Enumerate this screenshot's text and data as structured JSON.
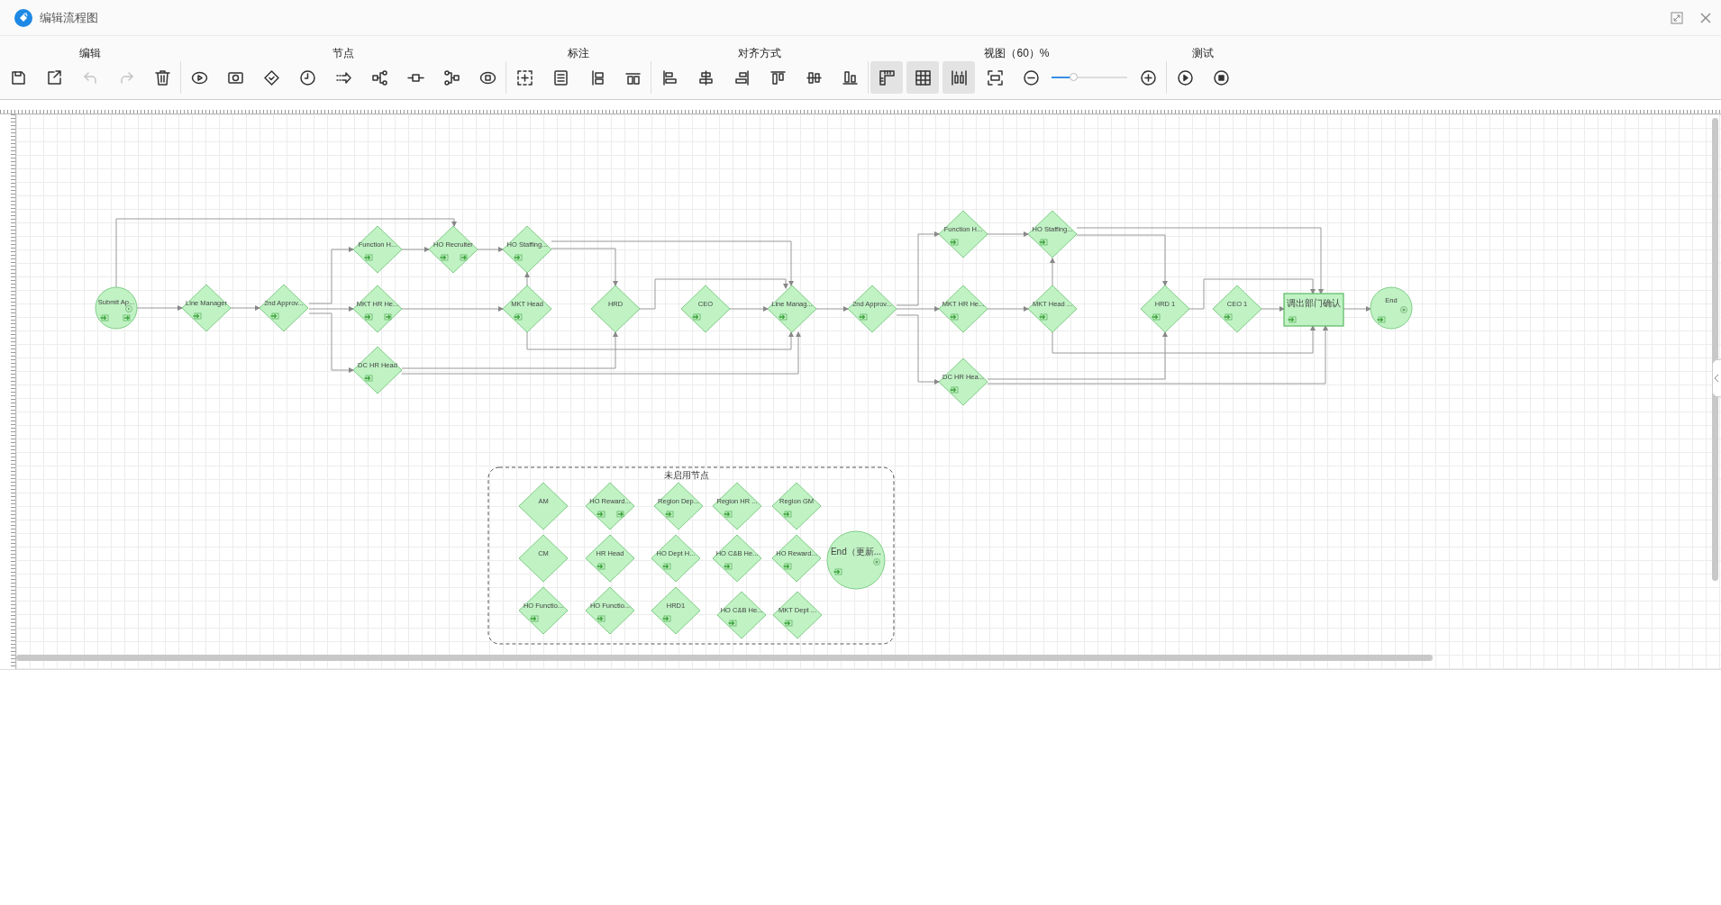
{
  "window": {
    "title": "编辑流程图"
  },
  "toolbar": {
    "groups": [
      {
        "label": "编辑",
        "items": [
          {
            "kind": "save",
            "disabled": false
          },
          {
            "kind": "export",
            "disabled": false
          },
          {
            "kind": "undo",
            "disabled": true
          },
          {
            "kind": "redo",
            "disabled": true
          },
          {
            "kind": "delete",
            "disabled": false
          }
        ]
      },
      {
        "label": "节点",
        "items": [
          {
            "kind": "start-node",
            "disabled": false
          },
          {
            "kind": "subprocess-node",
            "disabled": false
          },
          {
            "kind": "approval-node",
            "disabled": false
          },
          {
            "kind": "timer-node",
            "disabled": false
          },
          {
            "kind": "send-node",
            "disabled": false
          },
          {
            "kind": "branch-node",
            "disabled": false
          },
          {
            "kind": "join-node",
            "disabled": false
          },
          {
            "kind": "merge-node",
            "disabled": false
          },
          {
            "kind": "end-node",
            "disabled": false
          }
        ]
      },
      {
        "label": "标注",
        "items": [
          {
            "kind": "frame",
            "disabled": false
          },
          {
            "kind": "note",
            "disabled": false
          },
          {
            "kind": "vline",
            "disabled": false
          },
          {
            "kind": "hline",
            "disabled": false
          }
        ]
      },
      {
        "label": "对齐方式",
        "items": [
          {
            "kind": "align-left",
            "disabled": false
          },
          {
            "kind": "align-center",
            "disabled": false
          },
          {
            "kind": "align-right",
            "disabled": false
          },
          {
            "kind": "align-top",
            "disabled": false
          },
          {
            "kind": "align-middle",
            "disabled": false
          },
          {
            "kind": "align-bottom",
            "disabled": false
          }
        ]
      },
      {
        "label": "视图（60）%",
        "items": [
          {
            "kind": "ruler",
            "selected": true
          },
          {
            "kind": "grid",
            "selected": true
          },
          {
            "kind": "spacing",
            "selected": true
          },
          {
            "kind": "fit",
            "disabled": false
          },
          {
            "kind": "zoom-out",
            "disabled": false
          },
          {
            "kind": "slider",
            "level": 0.3
          },
          {
            "kind": "zoom-in",
            "disabled": false
          }
        ]
      },
      {
        "label": "测试",
        "items": [
          {
            "kind": "run",
            "disabled": false
          },
          {
            "kind": "stop",
            "disabled": false
          }
        ]
      }
    ]
  },
  "flow": {
    "nodes": [
      {
        "label": "Submit Ap...",
        "kind": "start",
        "entry_icon": true,
        "exit_icon": true
      },
      {
        "label": "Line Manager",
        "kind": "approval",
        "entry_icon": true,
        "exit_icon": false
      },
      {
        "label": "2nd Approv...",
        "kind": "approval",
        "entry_icon": true,
        "exit_icon": false
      },
      {
        "label": "Function H...",
        "kind": "approval",
        "entry_icon": true,
        "exit_icon": false
      },
      {
        "label": "MKT HR He...",
        "kind": "approval",
        "entry_icon": true,
        "exit_icon": true
      },
      {
        "label": "DC HR Head",
        "kind": "approval",
        "entry_icon": true,
        "exit_icon": false
      },
      {
        "label": "HO Recruiter",
        "kind": "approval",
        "entry_icon": true,
        "exit_icon": true
      },
      {
        "label": "HO Staffing...",
        "kind": "approval",
        "entry_icon": true,
        "exit_icon": false
      },
      {
        "label": "MKT Head",
        "kind": "approval",
        "entry_icon": true,
        "exit_icon": false
      },
      {
        "label": "HRD",
        "kind": "approval",
        "entry_icon": false,
        "exit_icon": false
      },
      {
        "label": "CEO",
        "kind": "approval",
        "entry_icon": true,
        "exit_icon": false
      },
      {
        "label": "Line Manag...",
        "kind": "approval",
        "entry_icon": true,
        "exit_icon": false
      },
      {
        "label": "2nd Approv...",
        "kind": "approval",
        "entry_icon": true,
        "exit_icon": false
      },
      {
        "label": "Function H...",
        "kind": "approval",
        "entry_icon": true,
        "exit_icon": false
      },
      {
        "label": "MKT HR He...",
        "kind": "approval",
        "entry_icon": true,
        "exit_icon": false
      },
      {
        "label": "DC HR Hea...",
        "kind": "approval",
        "entry_icon": true,
        "exit_icon": false
      },
      {
        "label": "HO Staffing...",
        "kind": "approval",
        "entry_icon": true,
        "exit_icon": false
      },
      {
        "label": "MKT Head ...",
        "kind": "approval",
        "entry_icon": true,
        "exit_icon": false
      },
      {
        "label": "HRD 1",
        "kind": "approval",
        "entry_icon": true,
        "exit_icon": false
      },
      {
        "label": "CEO 1",
        "kind": "approval",
        "entry_icon": true,
        "exit_icon": false
      },
      {
        "label": "调出部门确认",
        "kind": "confirm",
        "entry_icon": true,
        "exit_icon": false
      },
      {
        "label": "End",
        "kind": "end",
        "entry_icon": true,
        "exit_icon": false
      }
    ]
  },
  "unused_group": {
    "title": "未启用节点",
    "nodes": [
      {
        "label": "AM",
        "kind": "approval",
        "entry_icon": false,
        "exit_icon": false
      },
      {
        "label": "HO Reward...",
        "kind": "approval",
        "entry_icon": true,
        "exit_icon": true
      },
      {
        "label": "Region Dep...",
        "kind": "approval",
        "entry_icon": true,
        "exit_icon": false
      },
      {
        "label": "Region HR ...",
        "kind": "approval",
        "entry_icon": true,
        "exit_icon": false
      },
      {
        "label": "Region GM",
        "kind": "approval",
        "entry_icon": true,
        "exit_icon": false
      },
      {
        "label": "CM",
        "kind": "approval",
        "entry_icon": false,
        "exit_icon": false
      },
      {
        "label": "HR Head",
        "kind": "approval",
        "entry_icon": true,
        "exit_icon": false
      },
      {
        "label": "HO Dept H...",
        "kind": "approval",
        "entry_icon": true,
        "exit_icon": false
      },
      {
        "label": "HO C&B He...",
        "kind": "approval",
        "entry_icon": true,
        "exit_icon": false
      },
      {
        "label": "HO Reward...",
        "kind": "approval",
        "entry_icon": true,
        "exit_icon": false
      },
      {
        "label": "End（更新...",
        "kind": "end",
        "entry_icon": true,
        "exit_icon": false
      },
      {
        "label": "HO Functio...",
        "kind": "approval",
        "entry_icon": true,
        "exit_icon": false
      },
      {
        "label": "HO Functio...",
        "kind": "approval",
        "entry_icon": true,
        "exit_icon": false
      },
      {
        "label": "HRD1",
        "kind": "approval",
        "entry_icon": true,
        "exit_icon": false
      },
      {
        "label": "HO C&B He...",
        "kind": "approval",
        "entry_icon": true,
        "exit_icon": false
      },
      {
        "label": "MKT Dept ...",
        "kind": "approval",
        "entry_icon": true,
        "exit_icon": false
      }
    ]
  }
}
